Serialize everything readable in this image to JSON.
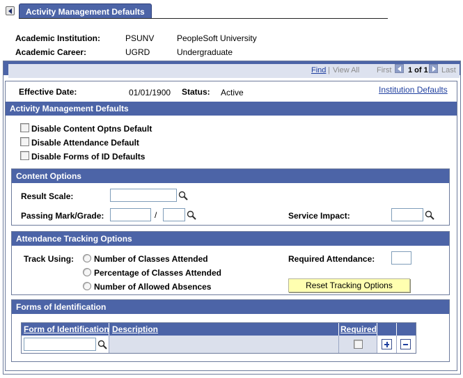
{
  "page": {
    "tab_title": "Activity Management Defaults"
  },
  "header": {
    "institution_label": "Academic Institution:",
    "institution_code": "PSUNV",
    "institution_name": "PeopleSoft University",
    "career_label": "Academic Career:",
    "career_code": "UGRD",
    "career_name": "Undergraduate"
  },
  "nav": {
    "find": "Find",
    "separator": "|",
    "view_all": "View All",
    "first": "First",
    "position": "1 of 1",
    "last": "Last"
  },
  "effective": {
    "date_label": "Effective Date:",
    "date_value": "01/01/1900",
    "status_label": "Status:",
    "status_value": "Active",
    "institution_defaults_link": "Institution Defaults"
  },
  "amd_section": {
    "title": "Activity Management Defaults",
    "checkboxes": [
      {
        "label": "Disable Content Optns Default",
        "checked": false
      },
      {
        "label": "Disable Attendance Default",
        "checked": false
      },
      {
        "label": "Disable Forms of ID Defaults",
        "checked": false
      }
    ]
  },
  "content_options": {
    "title": "Content Options",
    "result_scale_label": "Result Scale:",
    "result_scale_value": "",
    "passing_mark_label": "Passing Mark/Grade:",
    "passing_mark_value": "",
    "slash": "/",
    "passing_grade_value": "",
    "service_impact_label": "Service Impact:",
    "service_impact_value": ""
  },
  "attendance": {
    "title": "Attendance Tracking Options",
    "track_using_label": "Track Using:",
    "options": [
      {
        "label": "Number of Classes Attended",
        "selected": false
      },
      {
        "label": "Percentage of Classes Attended",
        "selected": false
      },
      {
        "label": "Number of Allowed Absences",
        "selected": false
      }
    ],
    "required_attendance_label": "Required Attendance:",
    "required_attendance_value": "",
    "reset_button": "Reset Tracking Options"
  },
  "forms_of_id": {
    "title": "Forms of Identification",
    "columns": [
      "Form of Identification",
      "Description",
      "Required"
    ],
    "rows": [
      {
        "form": "",
        "description": "",
        "required": false
      }
    ]
  },
  "colors": {
    "header_blue": "#4c64a7",
    "link_blue": "#1f3f9f",
    "button_yellow": "#ffffb0"
  }
}
